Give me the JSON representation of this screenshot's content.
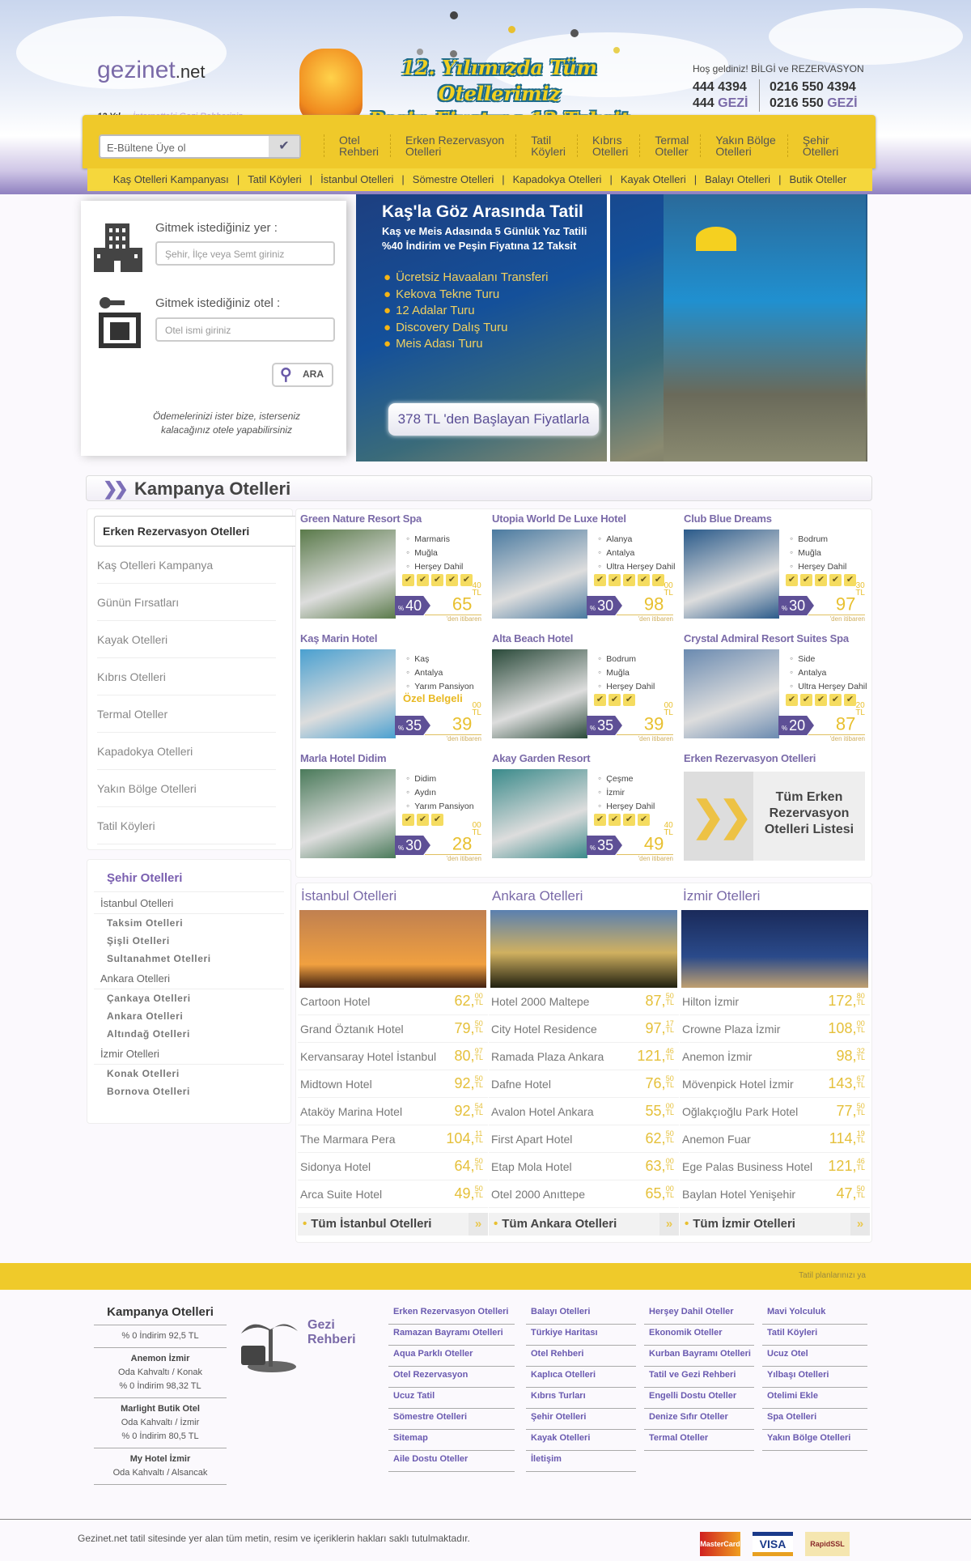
{
  "header": {
    "logo": "gezinet",
    "logo_tld": ".net",
    "tagline_years": "12 Yıl",
    "tagline": "İnternetteki",
    "tagline_b": "Gezi Rehberiniz",
    "promo_line1": "12. Yılımızda Tüm Otellerimiz",
    "promo_line2": "Peşin Fiyatına 12 Taksit",
    "welcome": "Hoş geldiniz!  BİLGİ ve REZERVASYON",
    "phone1": "444 4394",
    "phone1b_pre": "444 ",
    "phone1b_gz": "GEZİ",
    "phone2": "0216 550 4394",
    "phone2b_pre": "0216 550 ",
    "phone2b_gz": "GEZİ"
  },
  "nav": {
    "newsletter_placeholder": "E-Bültene Üye ol",
    "items": [
      "Otel\nRehberi",
      "Erken Rezervasyon\nOtelleri",
      "Tatil\nKöyleri",
      "Kıbrıs\nOtelleri",
      "Termal\nOteller",
      "Yakın Bölge\nOtelleri",
      "Şehir\nOtelleri"
    ],
    "sub": [
      "Kaş Otelleri Kampanyası",
      "Tatil Köyleri",
      "İstanbul Otelleri",
      "Sömestre Otelleri",
      "Kapadokya Otelleri",
      "Kayak Otelleri",
      "Balayı Otelleri",
      "Butik Oteller"
    ]
  },
  "search": {
    "dest_label": "Gitmek istediğiniz yer :",
    "dest_placeholder": "Şehir, İlçe veya Semt giriniz",
    "hotel_label": "Gitmek istediğiniz otel :",
    "hotel_placeholder": "Otel ismi giriniz",
    "button": "ARA",
    "quote": "Ödemelerinizi ister bize, isterseniz kalacağınız otele yapabilirsiniz"
  },
  "banner": {
    "title": "Kaş'la Göz Arasında  Tatil",
    "subtitle": "Kaş ve Meis Adasında 5 Günlük  Yaz Tatili\n%40 İndirim ve Peşin Fiyatına 12 Taksit",
    "features": [
      "Ücretsiz Havaalanı Transferi",
      "Kekova Tekne Turu",
      "12 Adalar Turu",
      "Discovery Dalış Turu",
      "Meis Adası Turu"
    ],
    "price": "378 TL 'den Başlayan Fiyatlarla"
  },
  "section_title": "Kampanya Otelleri",
  "sidebar": {
    "active": "Erken Rezervasyon Otelleri",
    "items": [
      "Kaş Otelleri Kampanya",
      "Günün Fırsatları",
      "Kayak Otelleri",
      "Kıbrıs Otelleri",
      "Termal Oteller",
      "Kapadokya Otelleri",
      "Yakın Bölge Otelleri",
      "Tatil Köyleri"
    ]
  },
  "city_sidebar": {
    "title": "Şehir Otelleri",
    "groups": [
      {
        "name": "İstanbul Otelleri",
        "subs": [
          "Taksim Otelleri",
          "Şişli Otelleri",
          "Sultanahmet Otelleri"
        ]
      },
      {
        "name": "Ankara Otelleri",
        "subs": [
          "Çankaya Otelleri",
          "Ankara Otelleri",
          "Altındağ Otelleri"
        ]
      },
      {
        "name": "İzmir Otelleri",
        "subs": [
          "Konak Otelleri",
          "Bornova Otelleri"
        ]
      }
    ]
  },
  "campaign": {
    "from_label": "'den itibaren",
    "currency": "TL",
    "hotels": [
      {
        "name": "Green Nature Resort Spa",
        "info": [
          "Marmaris",
          "Muğla",
          "Herşey Dahil"
        ],
        "stars": 5,
        "discount": "40",
        "price": "65",
        "cents": "40",
        "color": "#5a7a4a"
      },
      {
        "name": "Utopia World De Luxe Hotel",
        "info": [
          "Alanya",
          "Antalya",
          "Ultra Herşey Dahil"
        ],
        "stars": 5,
        "discount": "30",
        "price": "98",
        "cents": "00",
        "color": "#4a7aa0"
      },
      {
        "name": "Club Blue Dreams",
        "info": [
          "Bodrum",
          "Muğla",
          "Herşey Dahil"
        ],
        "stars": 5,
        "discount": "30",
        "price": "97",
        "cents": "30",
        "color": "#2a5a8a"
      },
      {
        "name": "Kaş Marin Hotel",
        "info": [
          "Kaş",
          "Antalya",
          "Yarım Pansiyon"
        ],
        "stars": 0,
        "badge": "Özel Belgeli",
        "discount": "35",
        "price": "39",
        "cents": "00",
        "color": "#4aa0d0"
      },
      {
        "name": "Alta Beach Hotel",
        "info": [
          "Bodrum",
          "Muğla",
          "Herşey Dahil"
        ],
        "stars": 3,
        "discount": "35",
        "price": "39",
        "cents": "00",
        "color": "#2a4a3a"
      },
      {
        "name": "Crystal Admiral Resort Suites Spa",
        "info": [
          "Side",
          "Antalya",
          "Ultra Herşey Dahil"
        ],
        "stars": 5,
        "discount": "20",
        "price": "87",
        "cents": "20",
        "color": "#6a8ab0"
      },
      {
        "name": "Marla Hotel Didim",
        "info": [
          "Didim",
          "Aydın",
          "Yarım Pansiyon"
        ],
        "stars": 3,
        "discount": "30",
        "price": "28",
        "cents": "00",
        "color": "#4a7a5a"
      },
      {
        "name": "Akay Garden Resort",
        "info": [
          "Çeşme",
          "İzmir",
          "Herşey Dahil"
        ],
        "stars": 4,
        "discount": "35",
        "price": "49",
        "cents": "40",
        "color": "#3a8a8a"
      }
    ],
    "all_title": "Erken Rezervasyon Otelleri",
    "all_text": "Tüm Erken Rezervasyon Otelleri Listesi"
  },
  "cities": [
    {
      "title": "İstanbul Otelleri",
      "all": "Tüm İstanbul Otelleri",
      "img": "linear-gradient(#c08050,#f0a040 70%,#402010)",
      "hotels": [
        [
          "Cartoon Hotel",
          "62",
          "00"
        ],
        [
          "Grand Öztanık Hotel",
          "79",
          "50"
        ],
        [
          "Kervansaray Hotel İstanbul",
          "80",
          "97"
        ],
        [
          "Midtown Hotel",
          "92",
          "50"
        ],
        [
          "Ataköy Marina Hotel",
          "92",
          "54"
        ],
        [
          "The Marmara Pera",
          "104",
          "11"
        ],
        [
          "Sidonya Hotel",
          "64",
          "50"
        ],
        [
          "Arca Suite Hotel",
          "49",
          "50"
        ]
      ]
    },
    {
      "title": "Ankara Otelleri",
      "all": "Tüm Ankara Otelleri",
      "img": "linear-gradient(#5a80b0,#d0b060 55%,#202010)",
      "hotels": [
        [
          "Hotel 2000 Maltepe",
          "87",
          "50"
        ],
        [
          "City Hotel Residence",
          "97",
          "17"
        ],
        [
          "Ramada Plaza Ankara",
          "121",
          "46"
        ],
        [
          "Dafne Hotel",
          "76",
          "50"
        ],
        [
          "Avalon Hotel Ankara",
          "55",
          "00"
        ],
        [
          "First Apart Hotel",
          "62",
          "50"
        ],
        [
          "Etap Mola Hotel",
          "63",
          "00"
        ],
        [
          "Otel 2000 Anıttepe",
          "65",
          "00"
        ]
      ]
    },
    {
      "title": "İzmir Otelleri",
      "all": "Tüm İzmir Otelleri",
      "img": "linear-gradient(#1a2a5a,#2a4a8a 60%,#c0a070)",
      "hotels": [
        [
          "Hilton İzmir",
          "172",
          "80"
        ],
        [
          "Crowne Plaza İzmir",
          "108",
          "00"
        ],
        [
          "Anemon İzmir",
          "98",
          "32"
        ],
        [
          "Mövenpick Hotel İzmir",
          "143",
          "67"
        ],
        [
          "Oğlakçıoğlu Park Hotel",
          "77",
          "50"
        ],
        [
          "Anemon Fuar",
          "114",
          "19"
        ],
        [
          "Ege Palas Business Hotel",
          "121",
          "46"
        ],
        [
          "Baylan Hotel Yenişehir",
          "47",
          "50"
        ]
      ]
    }
  ],
  "footer": {
    "bar_text": "Tatil planlarınızı ya",
    "camp_title": "Kampanya Otelleri",
    "camp_entries": [
      {
        "lines": [
          "% 0 İndirim 92,5 TL"
        ]
      },
      {
        "name": "Anemon İzmir",
        "lines": [
          "Oda Kahvaltı / Konak",
          "% 0 İndirim 98,32 TL"
        ]
      },
      {
        "name": "Marlight Butik Otel",
        "lines": [
          "Oda Kahvaltı / İzmir",
          "% 0 İndirim 80,5 TL"
        ]
      },
      {
        "name": "My Hotel İzmir",
        "lines": [
          "Oda Kahvaltı / Alsancak"
        ]
      }
    ],
    "gezi1": "Gezi",
    "gezi2": "Rehberi",
    "links": [
      [
        "Erken Rezervasyon Otelleri",
        "Ramazan Bayramı Otelleri",
        "Aqua Parklı Oteller",
        "Otel Rezervasyon",
        "Ucuz Tatil",
        "Sömestre Otelleri",
        "Sitemap",
        "Aile Dostu Oteller"
      ],
      [
        "Balayı Otelleri",
        "Türkiye Haritası",
        "Otel Rehberi",
        "Kaplıca Otelleri",
        "Kıbrıs Turları",
        "Şehir Otelleri",
        "Kayak Otelleri",
        "İletişim"
      ],
      [
        "Herşey Dahil Oteller",
        "Ekonomik Oteller",
        "Kurban Bayramı Otelleri",
        "Tatil ve Gezi Rehberi",
        "Engelli Dostu Oteller",
        "Denize Sıfır Oteller",
        "Termal Oteller"
      ],
      [
        "Mavi Yolculuk",
        "Tatil Köyleri",
        "Ucuz Otel",
        "Yılbaşı Otelleri",
        "Otelimi Ekle",
        "Spa Otelleri",
        "Yakın Bölge Otelleri"
      ]
    ],
    "copyright": "Gezinet.net tatil sitesinde yer alan tüm metin, resim ve içeriklerin hakları saklı tutulmaktadır.",
    "payment": [
      "MasterCard",
      "VISA",
      "RapidSSL"
    ]
  },
  "colors": {
    "accent_yellow": "#efca2a",
    "brand_purple": "#7a6aa8",
    "discount_purple": "#5e5096",
    "price_gold": "#e5c03a"
  }
}
